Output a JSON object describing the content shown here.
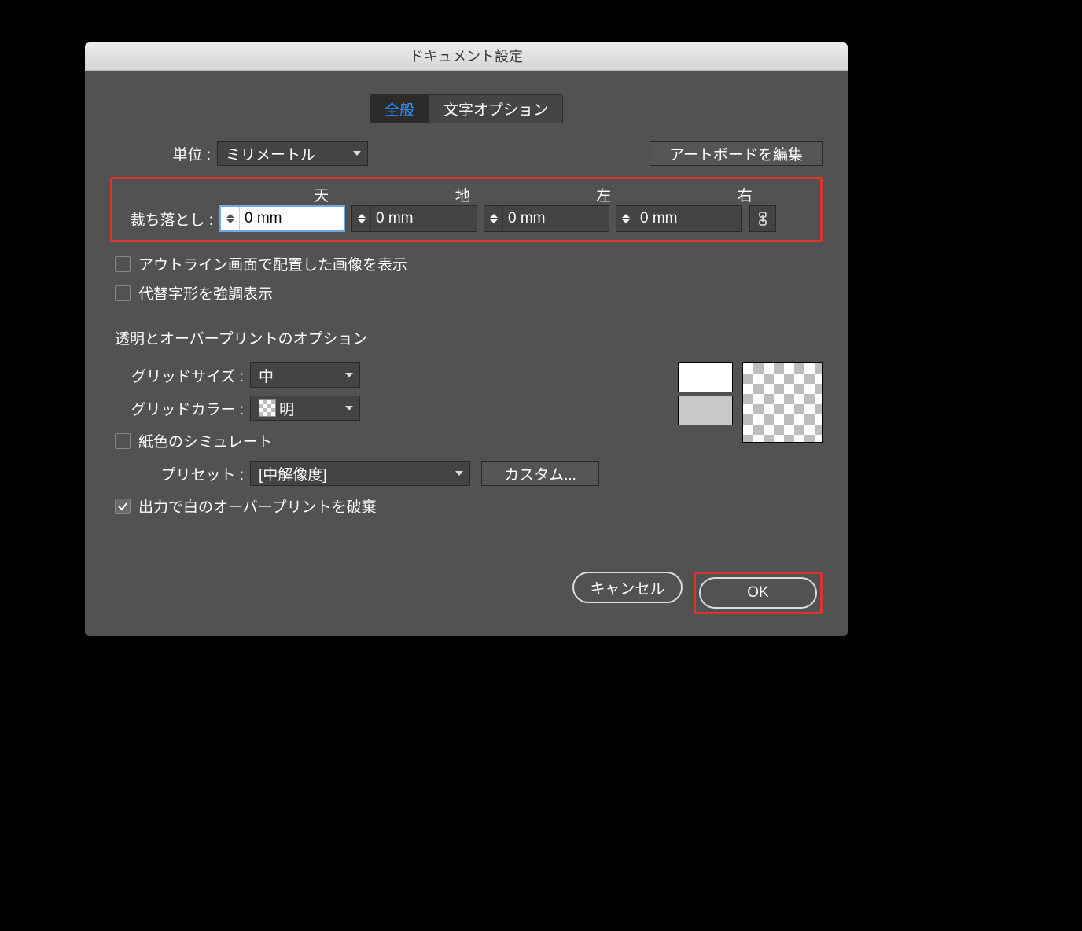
{
  "dialog": {
    "title": "ドキュメント設定",
    "tabs": {
      "general": "全般",
      "typeOptions": "文字オプション"
    },
    "unitsLabel": "単位 :",
    "unitsValue": "ミリメートル",
    "editArtboards": "アートボードを編集",
    "bleed": {
      "label": "裁ち落とし :",
      "topLabel": "天",
      "bottomLabel": "地",
      "leftLabel": "左",
      "rightLabel": "右",
      "top": "0 mm",
      "bottom": "0 mm",
      "left": "0 mm",
      "right": "0 mm"
    },
    "checkboxes": {
      "showImagesOutline": "アウトライン画面で配置した画像を表示",
      "highlightGlyphs": "代替字形を強調表示",
      "simulatePaper": "紙色のシミュレート",
      "discardWhiteOverprint": "出力で白のオーバープリントを破棄"
    },
    "overprintSection": "透明とオーバープリントのオプション",
    "gridSizeLabel": "グリッドサイズ :",
    "gridSizeValue": "中",
    "gridColorLabel": "グリッドカラー :",
    "gridColorValue": "明",
    "presetLabel": "プリセット :",
    "presetValue": "[中解像度]",
    "customBtn": "カスタム...",
    "cancel": "キャンセル",
    "ok": "OK"
  }
}
